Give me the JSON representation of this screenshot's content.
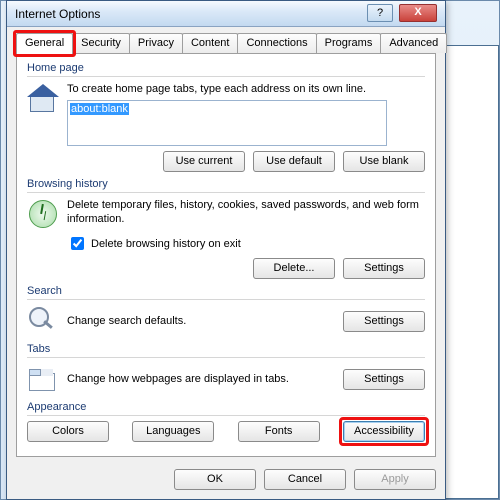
{
  "window": {
    "title": "Internet Options",
    "help": "?",
    "close": "X"
  },
  "tabs": [
    "General",
    "Security",
    "Privacy",
    "Content",
    "Connections",
    "Programs",
    "Advanced"
  ],
  "home": {
    "label": "Home page",
    "text": "To create home page tabs, type each address on its own line.",
    "value": "about:blank",
    "use_current": "Use current",
    "use_default": "Use default",
    "use_blank": "Use blank"
  },
  "hist": {
    "label": "Browsing history",
    "text": "Delete temporary files, history, cookies, saved passwords, and web form information.",
    "cb": "Delete browsing history on exit",
    "delete": "Delete...",
    "settings": "Settings"
  },
  "search": {
    "label": "Search",
    "text": "Change search defaults.",
    "settings": "Settings"
  },
  "tabsg": {
    "label": "Tabs",
    "text": "Change how webpages are displayed in tabs.",
    "settings": "Settings"
  },
  "appear": {
    "label": "Appearance",
    "colors": "Colors",
    "languages": "Languages",
    "fonts": "Fonts",
    "accessibility": "Accessibility"
  },
  "dlg": {
    "ok": "OK",
    "cancel": "Cancel",
    "apply": "Apply"
  }
}
